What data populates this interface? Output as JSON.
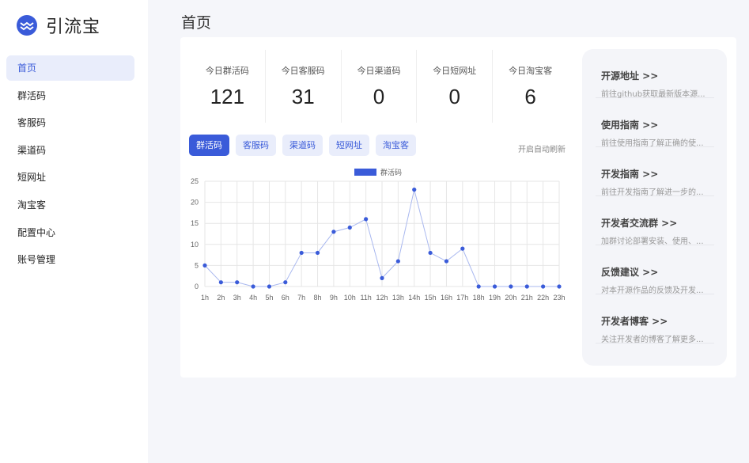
{
  "app": {
    "name": "引流宝"
  },
  "sidebar": {
    "items": [
      {
        "label": "首页",
        "active": true
      },
      {
        "label": "群活码",
        "active": false
      },
      {
        "label": "客服码",
        "active": false
      },
      {
        "label": "渠道码",
        "active": false
      },
      {
        "label": "短网址",
        "active": false
      },
      {
        "label": "淘宝客",
        "active": false
      },
      {
        "label": "配置中心",
        "active": false
      },
      {
        "label": "账号管理",
        "active": false
      }
    ]
  },
  "page": {
    "title": "首页"
  },
  "stats": [
    {
      "label": "今日群活码",
      "value": "121"
    },
    {
      "label": "今日客服码",
      "value": "31"
    },
    {
      "label": "今日渠道码",
      "value": "0"
    },
    {
      "label": "今日短网址",
      "value": "0"
    },
    {
      "label": "今日淘宝客",
      "value": "6"
    }
  ],
  "tabs": [
    {
      "label": "群活码",
      "active": true
    },
    {
      "label": "客服码",
      "active": false
    },
    {
      "label": "渠道码",
      "active": false
    },
    {
      "label": "短网址",
      "active": false
    },
    {
      "label": "淘宝客",
      "active": false
    }
  ],
  "auto_refresh_label": "开启自动刷新",
  "links": [
    {
      "title": "开源地址 >>",
      "desc": "前往github获取最新版本源..."
    },
    {
      "title": "使用指南 >>",
      "desc": "前往使用指南了解正确的使..."
    },
    {
      "title": "开发指南 >>",
      "desc": "前往开发指南了解进一步的..."
    },
    {
      "title": "开发者交流群 >>",
      "desc": "加群讨论部署安装、使用、..."
    },
    {
      "title": "反馈建议 >>",
      "desc": "对本开源作品的反馈及开发..."
    },
    {
      "title": "开发者博客 >>",
      "desc": "关注开发者的博客了解更多..."
    }
  ],
  "colors": {
    "accent": "#3a5bd9",
    "accent_light": "#e9edfb",
    "line": "#a9b8ef"
  },
  "chart_data": {
    "type": "line",
    "categories": [
      "1h",
      "2h",
      "3h",
      "4h",
      "5h",
      "6h",
      "7h",
      "8h",
      "9h",
      "10h",
      "11h",
      "12h",
      "13h",
      "14h",
      "15h",
      "16h",
      "17h",
      "18h",
      "19h",
      "20h",
      "21h",
      "22h",
      "23h"
    ],
    "series": [
      {
        "name": "群活码",
        "values": [
          5,
          1,
          1,
          0,
          0,
          1,
          8,
          8,
          13,
          14,
          16,
          2,
          6,
          23,
          8,
          6,
          9,
          0,
          0,
          0,
          0,
          0,
          0
        ]
      }
    ],
    "ylim": [
      0,
      25
    ],
    "yticks": [
      0,
      5,
      10,
      15,
      20,
      25
    ],
    "grid": true,
    "legend": "top-center"
  }
}
